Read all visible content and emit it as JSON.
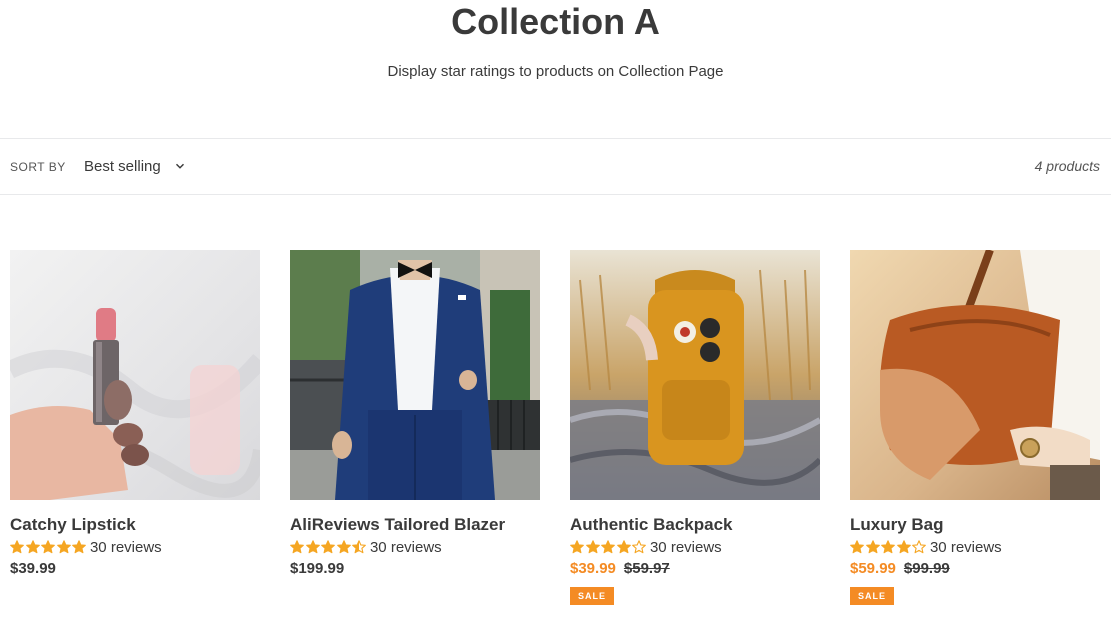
{
  "collection": {
    "title": "Collection A",
    "description": "Display star ratings to products on Collection Page"
  },
  "toolbar": {
    "sort_label": "SORT BY",
    "sort_value": "Best selling",
    "product_count": "4 products"
  },
  "colors": {
    "accent": "#f48b24",
    "star": "#f5a623",
    "text": "#3a3a3a"
  },
  "products": [
    {
      "name": "Catchy Lipstick",
      "rating": 5,
      "reviews": "30 reviews",
      "price": "$39.99",
      "compare_price": "",
      "badge": ""
    },
    {
      "name": "AliReviews Tailored Blazer",
      "rating": 4.5,
      "reviews": "30 reviews",
      "price": "$199.99",
      "compare_price": "",
      "badge": ""
    },
    {
      "name": "Authentic Backpack",
      "rating": 4,
      "reviews": "30 reviews",
      "price": "$39.99",
      "compare_price": "$59.97",
      "badge": "SALE"
    },
    {
      "name": "Luxury Bag",
      "rating": 4,
      "reviews": "30 reviews",
      "price": "$59.99",
      "compare_price": "$99.99",
      "badge": "SALE"
    }
  ]
}
